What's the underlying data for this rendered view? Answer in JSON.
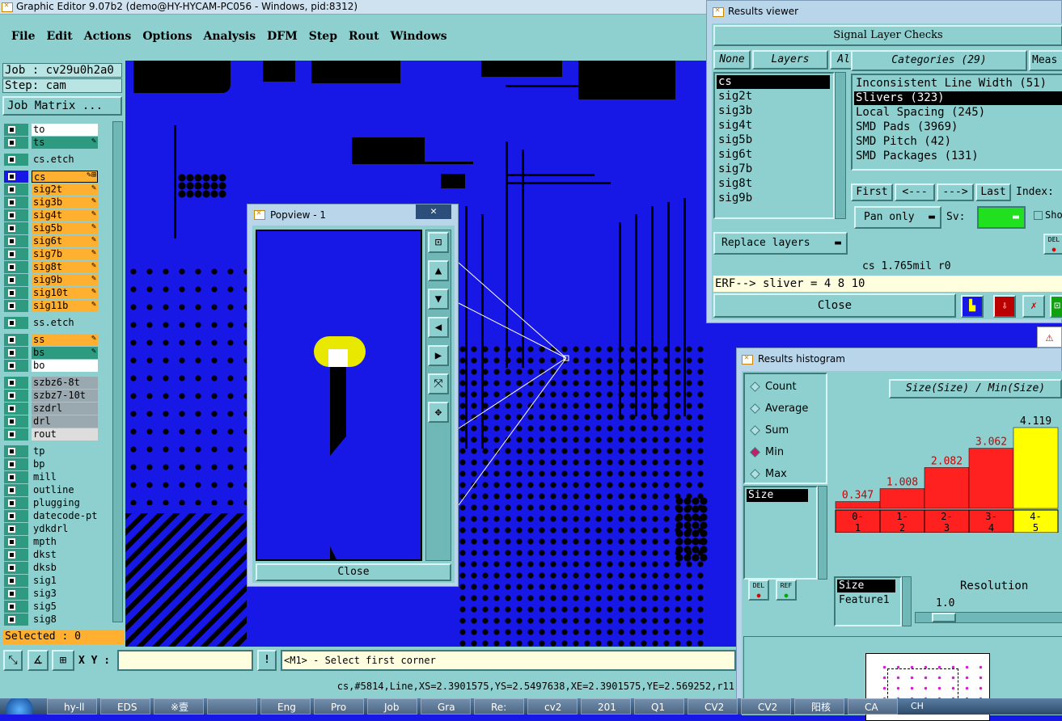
{
  "main_window": {
    "title": "Graphic Editor 9.07b2 (demo@HY-HYCAM-PC056 - Windows, pid:8312)",
    "menu": [
      "File",
      "Edit",
      "Actions",
      "Options",
      "Analysis",
      "DFM",
      "Step",
      "Rout",
      "Windows"
    ]
  },
  "job_panel": {
    "job": "Job : cv29u0h2a0",
    "step": "Step: cam",
    "job_matrix": "Job Matrix ...",
    "selected": "Selected : 0"
  },
  "layers": [
    {
      "name": "to",
      "color": "#ffffff"
    },
    {
      "name": "ts",
      "color": "#2e9b80",
      "edit": "✎"
    },
    {
      "name": "cs.etch",
      "color": "#8ecfcf",
      "gap": true
    },
    {
      "name": "cs",
      "color": "#ffb030",
      "edit": "✎⊞",
      "active": true,
      "gap": true
    },
    {
      "name": "sig2t",
      "color": "#ffb030",
      "edit": "✎"
    },
    {
      "name": "sig3b",
      "color": "#ffb030",
      "edit": "✎"
    },
    {
      "name": "sig4t",
      "color": "#ffb030",
      "edit": "✎"
    },
    {
      "name": "sig5b",
      "color": "#ffb030",
      "edit": "✎"
    },
    {
      "name": "sig6t",
      "color": "#ffb030",
      "edit": "✎"
    },
    {
      "name": "sig7b",
      "color": "#ffb030",
      "edit": "✎"
    },
    {
      "name": "sig8t",
      "color": "#ffb030",
      "edit": "✎"
    },
    {
      "name": "sig9b",
      "color": "#ffb030",
      "edit": "✎"
    },
    {
      "name": "sig10t",
      "color": "#ffb030",
      "edit": "✎"
    },
    {
      "name": "sig11b",
      "color": "#ffb030",
      "edit": "✎"
    },
    {
      "name": "ss.etch",
      "color": "#8ecfcf",
      "gap": true
    },
    {
      "name": "ss",
      "color": "#ffb030",
      "edit": "✎",
      "gap": true
    },
    {
      "name": "bs",
      "color": "#2e9b80",
      "edit": "✎"
    },
    {
      "name": "bo",
      "color": "#ffffff"
    },
    {
      "name": "szbz6-8t",
      "color": "#9aa9b0",
      "gap": true
    },
    {
      "name": "szbz7-10t",
      "color": "#9aa9b0"
    },
    {
      "name": "szdrl",
      "color": "#9aa9b0"
    },
    {
      "name": "drl",
      "color": "#9aa9b0"
    },
    {
      "name": "rout",
      "color": "#dddddd"
    },
    {
      "name": "tp",
      "color": "#8ecfcf",
      "gap": true
    },
    {
      "name": "bp",
      "color": "#8ecfcf"
    },
    {
      "name": "mill",
      "color": "#8ecfcf"
    },
    {
      "name": "outline",
      "color": "#8ecfcf"
    },
    {
      "name": "plugging",
      "color": "#8ecfcf"
    },
    {
      "name": "datecode-pt",
      "color": "#8ecfcf"
    },
    {
      "name": "ydkdrl",
      "color": "#8ecfcf"
    },
    {
      "name": "mpth",
      "color": "#8ecfcf"
    },
    {
      "name": "dkst",
      "color": "#8ecfcf"
    },
    {
      "name": "dksb",
      "color": "#8ecfcf"
    },
    {
      "name": "sig1",
      "color": "#8ecfcf"
    },
    {
      "name": "sig3",
      "color": "#8ecfcf"
    },
    {
      "name": "sig5",
      "color": "#8ecfcf"
    },
    {
      "name": "sig8",
      "color": "#8ecfcf"
    }
  ],
  "bottom_bar": {
    "xy_label": "X Y :",
    "xy_value": "",
    "prompt": "<M1> - Select first corner",
    "status": "cs,#5814,Line,XS=2.3901575,YS=2.5497638,XE=2.3901575,YE=2.569252,r11"
  },
  "popview": {
    "title": "Popview - 1",
    "close": "Close"
  },
  "results_viewer": {
    "title": "Results viewer",
    "header": "Signal Layer Checks",
    "none": "None",
    "layers_label": "Layers",
    "all": "All",
    "layers": [
      "cs",
      "sig2t",
      "sig3b",
      "sig4t",
      "sig5b",
      "sig6t",
      "sig7b",
      "sig8t",
      "sig9b"
    ],
    "categories_label": "Categories (29)",
    "meas_label": "Meas",
    "categories": [
      "Inconsistent Line Width (51)",
      "Slivers (323)",
      "Local Spacing (245)",
      "SMD Pads (3969)",
      "SMD Pitch (42)",
      "SMD Packages (131)"
    ],
    "first": "First",
    "prev": "<---",
    "next": "--->",
    "last": "Last",
    "index": "Index:",
    "pan_only": "Pan only",
    "sv": "Sv:",
    "show": "Sho",
    "replace_layers": "Replace layers",
    "del": "DEL",
    "info": "cs 1.765mil  r0",
    "erf": "ERF--> sliver = 4 8 10",
    "close": "Close"
  },
  "histogram": {
    "title": "Results histogram",
    "options": [
      "Count",
      "Average",
      "Sum",
      "Min",
      "Max"
    ],
    "selected_option": "Min",
    "header": "Size(Size) / Min(Size)",
    "size_label": "Size",
    "feature_label": "Feature1",
    "resolution_label": "Resolution",
    "resolution_value": "1.0",
    "del": "DEL",
    "ref": "REF"
  },
  "chart_data": {
    "type": "bar",
    "categories": [
      "0-1",
      "1-2",
      "2-3",
      "3-4",
      "4-5"
    ],
    "values": [
      0.347,
      1.008,
      2.082,
      3.062,
      4.119
    ],
    "labels": [
      "0.347",
      "1.008",
      "2.082",
      "3.062",
      "4.119"
    ],
    "cat_top": [
      "0-",
      "1-",
      "2-",
      "3-",
      "4-"
    ],
    "cat_bottom": [
      "1",
      "2",
      "3",
      "4",
      "5"
    ],
    "colors": [
      "#ff2020",
      "#ff2020",
      "#ff2020",
      "#ff2020",
      "#ffff00"
    ]
  },
  "taskbar": {
    "items": [
      "hy-ll",
      "EDS",
      "※壹",
      "",
      "Eng",
      "Pro",
      "Job",
      "Gra",
      "Re:",
      "cv2",
      "201",
      "Q1",
      "CV2",
      "CV2",
      "阳核",
      "CA"
    ],
    "tray": "CH"
  }
}
